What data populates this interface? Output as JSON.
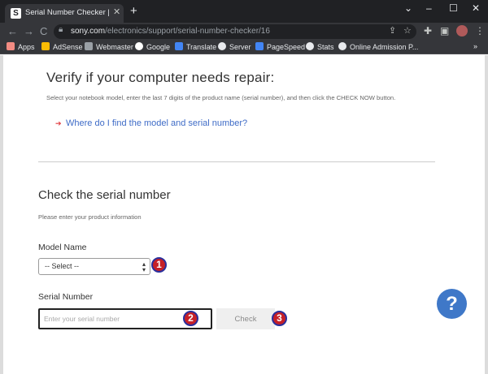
{
  "browser": {
    "tab_title": "Serial Number Checker | Sony US",
    "tab_favicon": "S",
    "tab_close": "✕",
    "new_tab": "+",
    "window": {
      "menu": "⌄",
      "minimize": "–",
      "maximize": "☐",
      "close": "✕"
    },
    "nav": {
      "back": "←",
      "forward": "→",
      "reload": "C"
    },
    "url_host": "sony.com",
    "url_path": "/electronics/support/serial-number-checker/16",
    "bookmarks_more": "»",
    "bookmarks": [
      {
        "label": "Apps",
        "icon": "apps-grid-icon",
        "color": "#f28b82"
      },
      {
        "label": "AdSense",
        "icon": "adsense-icon",
        "color": "#fbbc04"
      },
      {
        "label": "Webmaster",
        "icon": "webmaster-icon",
        "color": "#9aa0a6"
      },
      {
        "label": "Google",
        "icon": "google-icon",
        "color": "#ffffff"
      },
      {
        "label": "Translate",
        "icon": "translate-icon",
        "color": "#4285f4"
      },
      {
        "label": "Server",
        "icon": "globe-icon",
        "color": "#e8eaed"
      },
      {
        "label": "PageSpeed",
        "icon": "pagespeed-icon",
        "color": "#4285f4"
      },
      {
        "label": "Stats",
        "icon": "wordpress-icon",
        "color": "#e8eaed"
      },
      {
        "label": "Online Admission P...",
        "icon": "globe-icon",
        "color": "#e8eaed"
      }
    ]
  },
  "page": {
    "heading": "Verify if your computer needs repair:",
    "instructions": "Select your notebook model, enter the last 7 digits of the product name (serial number), and then click the CHECK NOW button.",
    "find_link": "Where do I find the model and serial number?",
    "check_heading": "Check the serial number",
    "please_enter": "Please enter your product information",
    "model_label": "Model Name",
    "model_select_value": "-- Select --",
    "serial_label": "Serial Number",
    "serial_placeholder": "Enter your serial number",
    "check_button": "Check",
    "help_button": "?"
  },
  "annotations": [
    "1",
    "2",
    "3"
  ],
  "colors": {
    "link": "#3f6cc7",
    "badge_fill": "#c62028",
    "badge_border": "#2a2f9c",
    "help_button": "#3f78c8"
  }
}
